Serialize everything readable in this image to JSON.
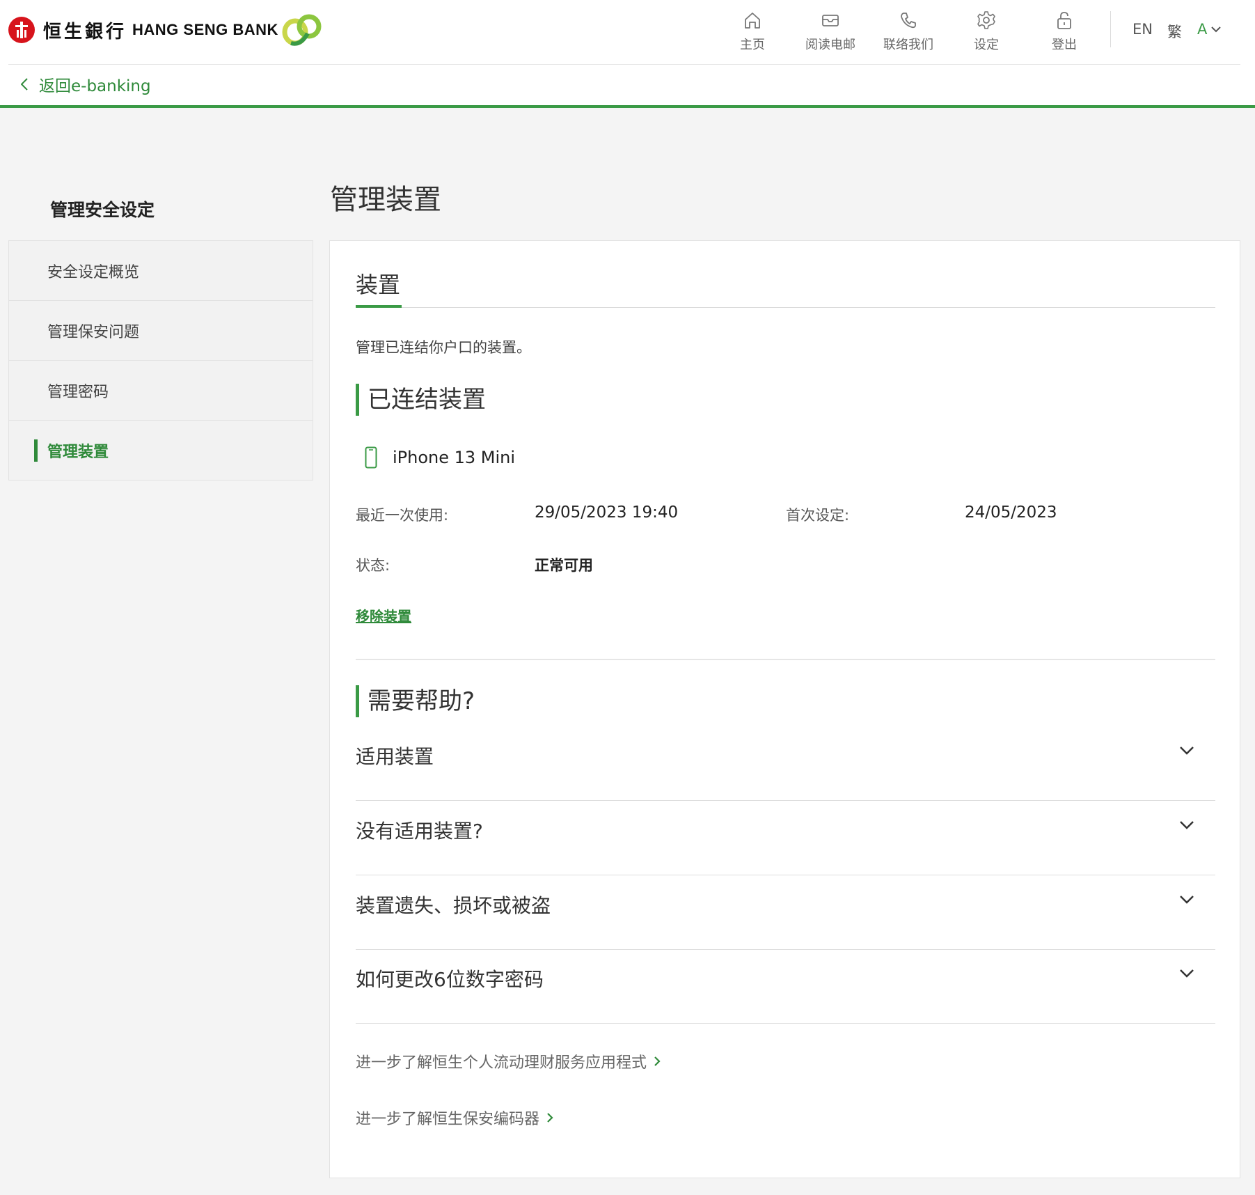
{
  "header": {
    "logo_cn": "恒生銀行",
    "logo_en": "HANG SENG BANK",
    "nav": [
      {
        "label": "主页",
        "icon": "home-icon"
      },
      {
        "label": "阅读电邮",
        "icon": "mail-icon"
      },
      {
        "label": "联络我们",
        "icon": "phone-icon"
      },
      {
        "label": "设定",
        "icon": "gear-icon"
      },
      {
        "label": "登出",
        "icon": "unlock-icon"
      }
    ],
    "lang_en": "EN",
    "lang_tc": "繁",
    "font_size": "A"
  },
  "back_link": "返回e-banking",
  "sidebar": {
    "title": "管理安全设定",
    "items": [
      {
        "label": "安全设定概览"
      },
      {
        "label": "管理保安问题"
      },
      {
        "label": "管理密码"
      },
      {
        "label": "管理装置",
        "active": true
      }
    ]
  },
  "main": {
    "page_title": "管理装置",
    "tab": "装置",
    "description": "管理已连结你户口的装置。",
    "linked_heading": "已连结装置",
    "device": {
      "name": "iPhone 13 Mini",
      "last_used_label": "最近一次使用:",
      "last_used_value": "29/05/2023 19:40",
      "first_setup_label": "首次设定:",
      "first_setup_value": "24/05/2023",
      "status_label": "状态:",
      "status_value": "正常可用",
      "remove_label": "移除装置"
    },
    "help_heading": "需要帮助?",
    "faq": [
      {
        "label": "适用装置"
      },
      {
        "label": "没有适用装置?"
      },
      {
        "label": "装置遗失、损坏或被盗"
      },
      {
        "label": "如何更改6位数字密码"
      }
    ],
    "links": [
      {
        "label": "进一步了解恒生个人流动理财服务应用程式"
      },
      {
        "label": "进一步了解恒生保安编码器"
      }
    ]
  },
  "colors": {
    "accent_green": "#3a9a45",
    "brand_red": "#d7141c"
  }
}
